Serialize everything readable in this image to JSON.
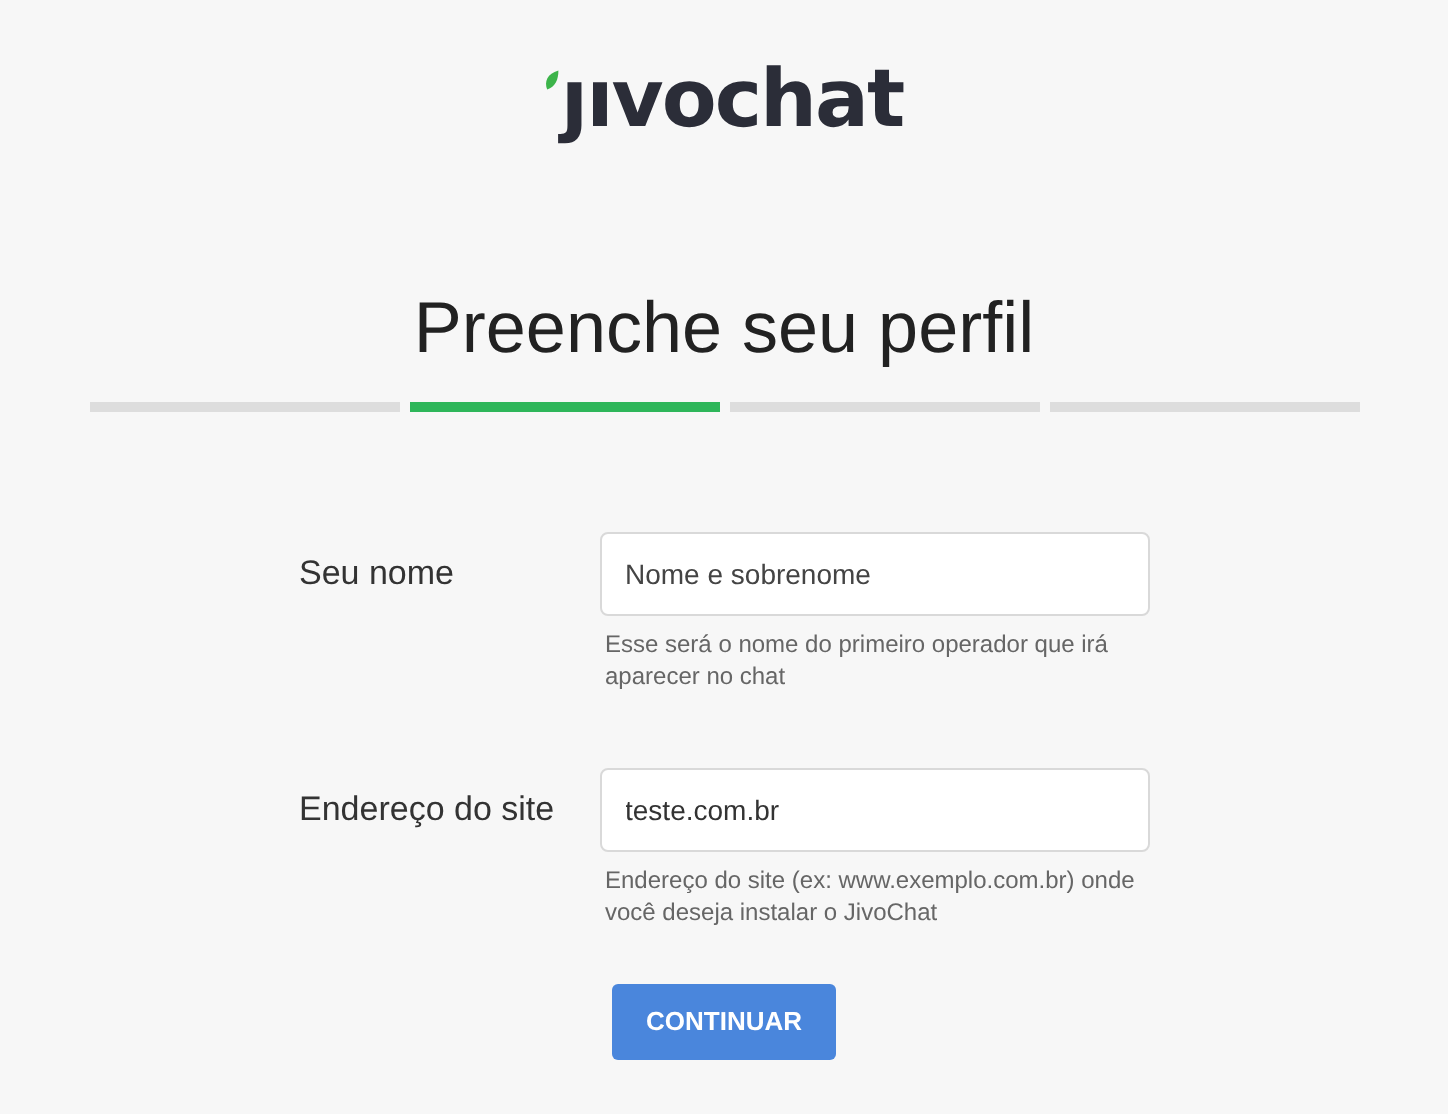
{
  "logo": "ȷıvochat",
  "title": "Preenche seu perfil",
  "steps": [
    {
      "selected": false
    },
    {
      "selected": true
    },
    {
      "selected": false
    },
    {
      "selected": false
    }
  ],
  "fields": [
    {
      "label": "Seu nome",
      "placeholder": "Nome e sobrenome",
      "hint": "Esse será o nome do primeiro operador que irá aparecer no chat"
    },
    {
      "label": "Endereço do site",
      "value": "teste.com.br",
      "hint": "Endereço do site (ex: www.exemplo.com.br) onde você deseja instalar o JivoChat"
    }
  ],
  "button": "CONTINUAR"
}
